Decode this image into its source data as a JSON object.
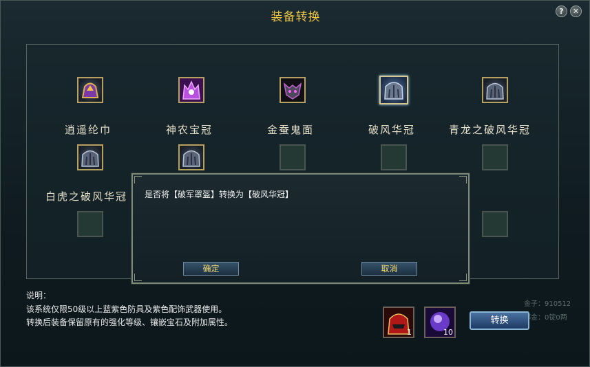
{
  "window": {
    "title": "装备转换",
    "help_label": "?",
    "close_label": "✕"
  },
  "slots": [
    {
      "label": "逍遥纶巾",
      "icon": "purple-gold-helmet-icon"
    },
    {
      "label": "神农宝冠",
      "icon": "violet-crown-icon"
    },
    {
      "label": "金蚕鬼面",
      "icon": "demon-mask-icon"
    },
    {
      "label": "破风华冠",
      "icon": "wind-crown-icon"
    },
    {
      "label": "青龙之破风华冠",
      "icon": "dragon-crown-icon"
    },
    {
      "label": "白虎之破风华冠",
      "icon": "tiger-crown-icon"
    }
  ],
  "dialog": {
    "message": "是否将【破军罩盔】转换为【破风华冠】",
    "confirm_label": "确定",
    "cancel_label": "取消"
  },
  "description": {
    "heading": "说明：",
    "line1": "该系统仅限50级以上蓝紫色防具及紫色配饰武器使用。",
    "line2": "转换后装备保留原有的强化等级、镶嵌宝石及附加属性。"
  },
  "materials": [
    {
      "icon": "red-warrior-helmet-icon",
      "count": "1"
    },
    {
      "icon": "purple-gem-icon",
      "count": "10"
    }
  ],
  "convert_label": "转换",
  "background": {
    "gold_label": "金子：",
    "gold_value": "910512",
    "bound_label": "绑金：",
    "bound_value": "0锭0两"
  }
}
